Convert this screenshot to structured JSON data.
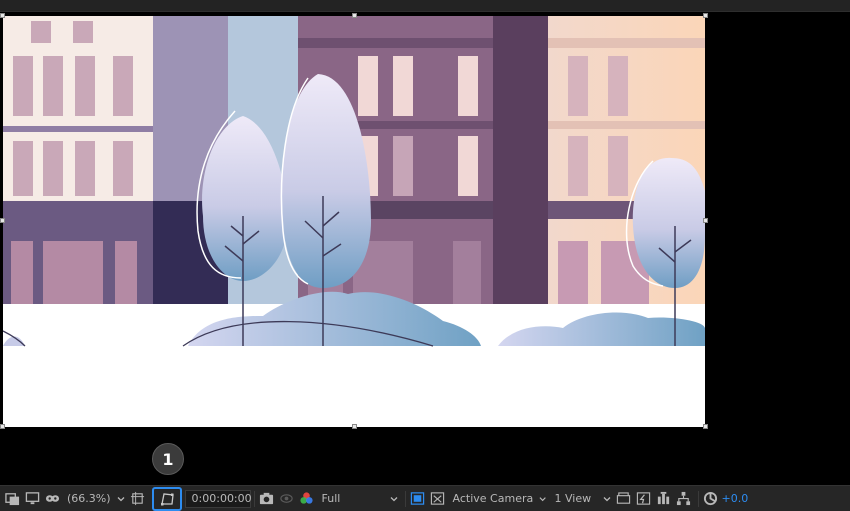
{
  "callout": {
    "number": "1"
  },
  "toolbar": {
    "zoom": "(66.3%)",
    "timecode": "0:00:00:00",
    "resolution": "Full",
    "camera": "Active Camera",
    "views": "1 View",
    "exposure": "+0.0"
  },
  "colors": {
    "highlight": "#2d8cf0",
    "toolbar_bg": "#262626",
    "viewer_bg": "#000000",
    "exposure_text": "#2d8cf0"
  },
  "icons": [
    "region-of-interest-icon",
    "display-icon",
    "mask-visibility-icon",
    "zoom-chevron-icon",
    "grid-guides-icon",
    "toggle-mask-path-icon",
    "camera-snapshot-icon",
    "show-snapshot-icon",
    "color-channels-icon",
    "fast-previews-icon",
    "transparency-grid-icon",
    "3d-view-icon",
    "timeline-icon",
    "flowchart-icon",
    "reset-exposure-icon"
  ]
}
